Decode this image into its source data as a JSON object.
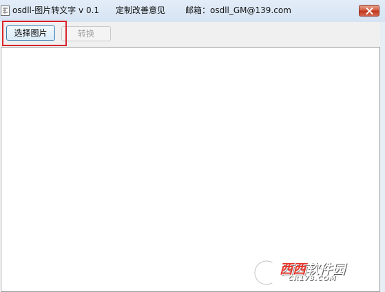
{
  "window": {
    "title": "osdll-图片转文字 v 0.1",
    "custom_link": "定制改善意见",
    "email_text": "邮箱：osdll_GM@139.com",
    "app_icon": "app-icon",
    "close_icon": "close-icon"
  },
  "toolbar": {
    "select_image_label": "选择图片",
    "convert_label": "转换"
  },
  "colors": {
    "highlight": "#d8232a",
    "titlebar": "#dae6f5",
    "close_button": "#c9442a"
  },
  "watermark": {
    "brand_red": "西西",
    "brand_white": "软件园",
    "site": "CR173.COM",
    "logo_icon": "cr173-logo-icon"
  }
}
